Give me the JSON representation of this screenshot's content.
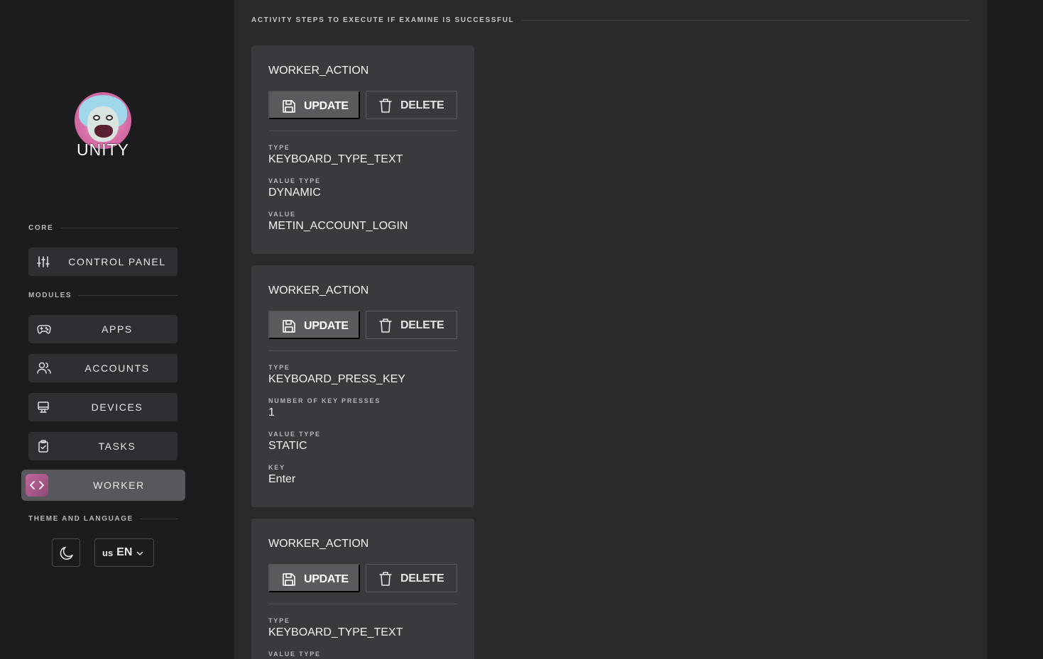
{
  "brand": {
    "name": "UNITY",
    "avatar_icon": "rick-avatar-icon"
  },
  "sidebar": {
    "sections": {
      "core": "CORE",
      "modules": "MODULES",
      "theme_language": "THEME AND LANGUAGE"
    },
    "core_items": [
      {
        "label": "CONTROL PANEL",
        "icon": "sliders-icon"
      }
    ],
    "module_items": [
      {
        "label": "APPS",
        "icon": "gamepad-icon"
      },
      {
        "label": "ACCOUNTS",
        "icon": "users-icon"
      },
      {
        "label": "DEVICES",
        "icon": "monitor-icon"
      },
      {
        "label": "TASKS",
        "icon": "clipboard-check-icon"
      },
      {
        "label": "WORKER",
        "icon": "code-icon",
        "active": true
      }
    ],
    "theme_toggle": {
      "icon": "moon-icon"
    },
    "language": {
      "flag": "us",
      "code": "EN",
      "icon": "chevron-down-icon"
    }
  },
  "main": {
    "heading": "ACTIVITY STEPS TO EXECUTE IF EXAMINE IS SUCCESSFUL",
    "cards": [
      {
        "title": "WORKER_ACTION",
        "update_label": "UPDATE",
        "delete_label": "DELETE",
        "fields": [
          {
            "label": "TYPE",
            "value": "KEYBOARD_TYPE_TEXT"
          },
          {
            "label": "VALUE TYPE",
            "value": "DYNAMIC"
          },
          {
            "label": "VALUE",
            "value": "METIN_ACCOUNT_LOGIN"
          }
        ]
      },
      {
        "title": "WORKER_ACTION",
        "update_label": "UPDATE",
        "delete_label": "DELETE",
        "fields": [
          {
            "label": "TYPE",
            "value": "KEYBOARD_PRESS_KEY"
          },
          {
            "label": "NUMBER OF KEY PRESSES",
            "value": "1"
          },
          {
            "label": "VALUE TYPE",
            "value": "STATIC"
          },
          {
            "label": "KEY",
            "value": "Enter"
          }
        ]
      },
      {
        "title": "WORKER_ACTION",
        "update_label": "UPDATE",
        "delete_label": "DELETE",
        "fields": [
          {
            "label": "TYPE",
            "value": "KEYBOARD_TYPE_TEXT"
          },
          {
            "label": "VALUE TYPE",
            "value": ""
          }
        ]
      }
    ]
  },
  "colors": {
    "background": "#1c1c1f",
    "panel": "#2a2a2d",
    "card": "#3a3a3e",
    "accent": "#c2679b"
  }
}
